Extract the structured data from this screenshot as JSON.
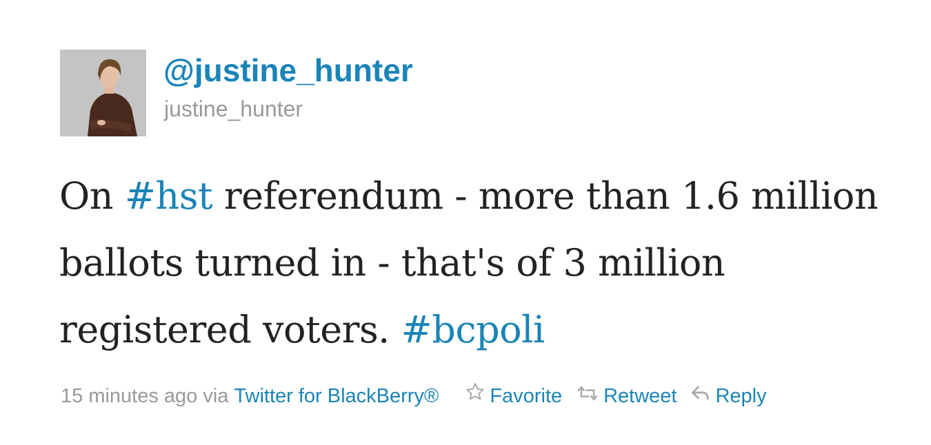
{
  "author": {
    "handle": "@justine_hunter",
    "screen_name": "justine_hunter",
    "avatar_icon": "user-avatar-photo"
  },
  "tweet": {
    "segments": [
      {
        "text": "On ",
        "type": "text"
      },
      {
        "text": "#hst",
        "type": "hashtag"
      },
      {
        "text": " referendum - more than 1.6 million ballots turned in - that's of 3 million registered voters. ",
        "type": "text"
      },
      {
        "text": "#bcpoli",
        "type": "hashtag"
      }
    ]
  },
  "meta": {
    "timestamp": "15 minutes ago",
    "via": "via",
    "source": "Twitter for BlackBerry®"
  },
  "actions": {
    "favorite": {
      "label": "Favorite",
      "icon": "star-icon"
    },
    "retweet": {
      "label": "Retweet",
      "icon": "retweet-icon"
    },
    "reply": {
      "label": "Reply",
      "icon": "reply-icon"
    }
  },
  "colors": {
    "link": "#1b84b8",
    "muted": "#999999",
    "text": "#222222"
  }
}
